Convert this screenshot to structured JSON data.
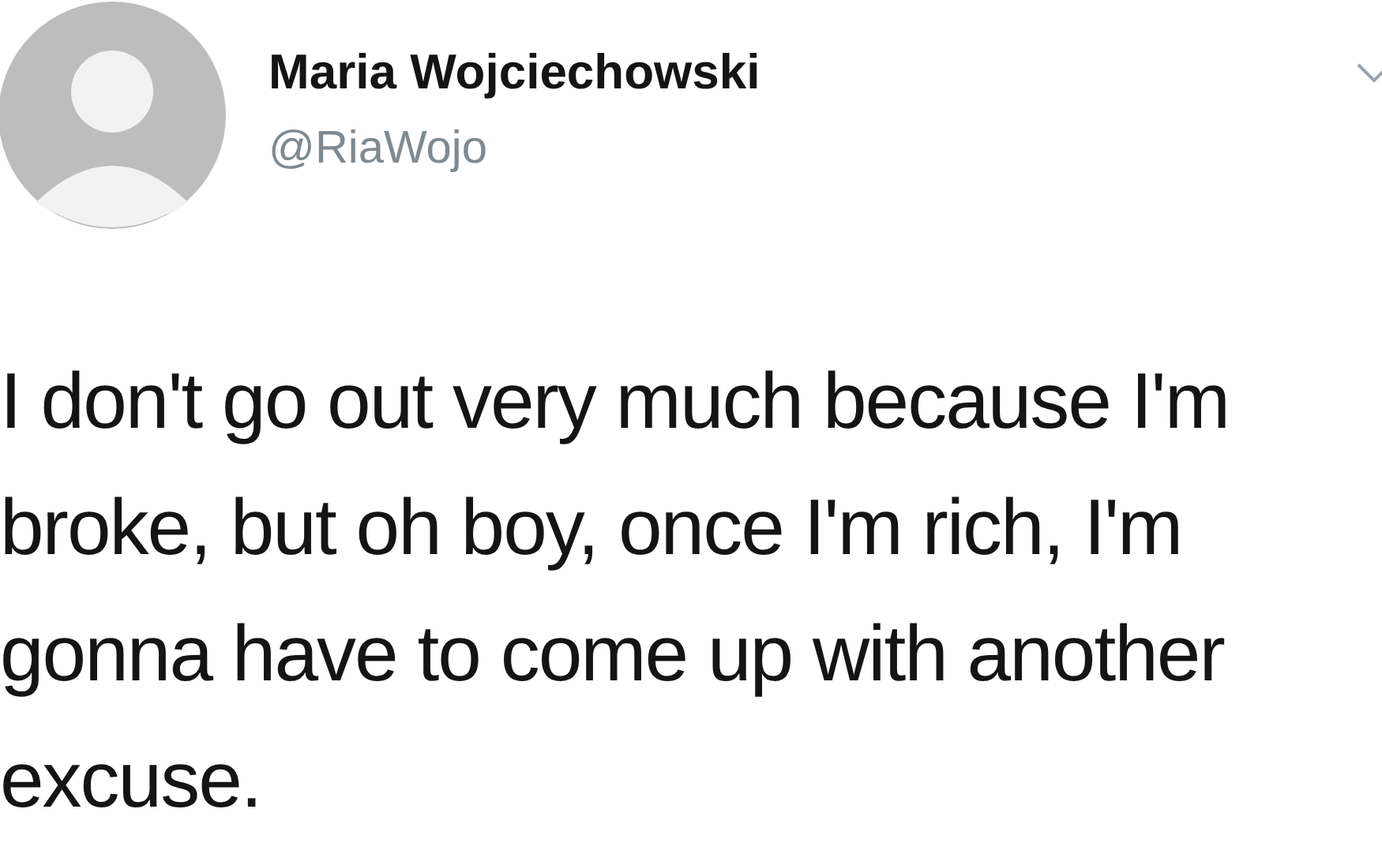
{
  "author": {
    "name": "Maria Wojciechowski",
    "handle": "@RiaWojo"
  },
  "tweet": {
    "text": "I don't go out very much because I'm broke, but oh boy, once I'm rich, I'm gonna have to come up with another excuse."
  }
}
